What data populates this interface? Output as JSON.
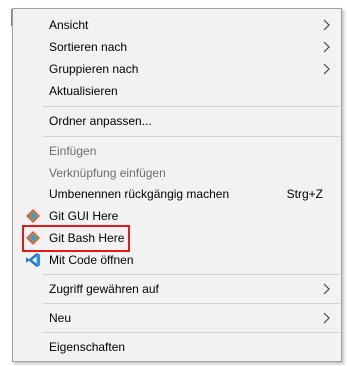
{
  "menu": {
    "items": [
      {
        "label": "Ansicht"
      },
      {
        "label": "Sortieren nach"
      },
      {
        "label": "Gruppieren nach"
      },
      {
        "label": "Aktualisieren"
      },
      {
        "label": "Ordner anpassen..."
      },
      {
        "label": "Einfügen"
      },
      {
        "label": "Verknüpfung einfügen"
      },
      {
        "label": "Umbenennen rückgängig machen",
        "shortcut": "Strg+Z"
      },
      {
        "label": "Git GUI Here"
      },
      {
        "label": "Git Bash Here"
      },
      {
        "label": "Mit Code öffnen"
      },
      {
        "label": "Zugriff gewähren auf"
      },
      {
        "label": "Neu"
      },
      {
        "label": "Eigenschaften"
      }
    ]
  },
  "colors": {
    "menu_background": "#f2f2f2",
    "disabled_text": "#6d6d6d",
    "highlight_border": "#e01b1b",
    "separator": "#d2d2d2"
  },
  "icons": {
    "git_gui": "git-diamond-icon",
    "git_bash": "git-diamond-icon",
    "vscode": "vscode-icon",
    "submenu": "chevron-right-icon",
    "cursor": "mouse-pointer-icon"
  }
}
